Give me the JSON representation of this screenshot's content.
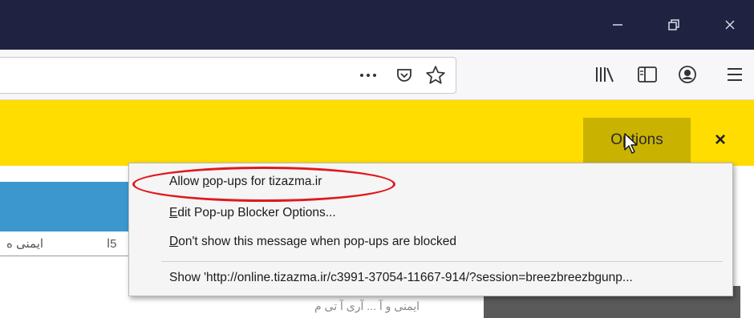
{
  "window": {
    "controls": [
      "minimize-icon",
      "restore-icon",
      "close-icon"
    ],
    "title_bar_color": "#1f2240"
  },
  "toolbar": {
    "url_value": "",
    "url_actions": [
      "more-icon",
      "pocket-icon",
      "bookmark-star-icon"
    ],
    "right_icons": [
      "library-icon",
      "sidebar-icon",
      "account-icon",
      "menu-icon"
    ]
  },
  "notification_bar": {
    "color": "#ffdd00",
    "options_label": {
      "pre": "O",
      "accel": "p",
      "post": "tions"
    },
    "close_label": "×"
  },
  "page": {
    "text_a": "ایمنی ه",
    "text_b": "5ا",
    "faint_text": "ایمنی و آ ... آری آ تی م"
  },
  "popup_menu": {
    "items": [
      {
        "pre": "Allow ",
        "accel": "p",
        "post": "op-ups for tizazma.ir"
      },
      {
        "pre": "",
        "accel": "E",
        "post": "dit Pop-up Blocker Options..."
      },
      {
        "pre": "",
        "accel": "D",
        "post": "on't show this message when pop-ups are blocked"
      },
      {
        "pre": "",
        "accel": "",
        "post": "Show 'http://online.tizazma.ir/c3991-37054-11667-914/?session=breezbreezbgunp..."
      }
    ],
    "highlight_color": "#e0191f"
  }
}
